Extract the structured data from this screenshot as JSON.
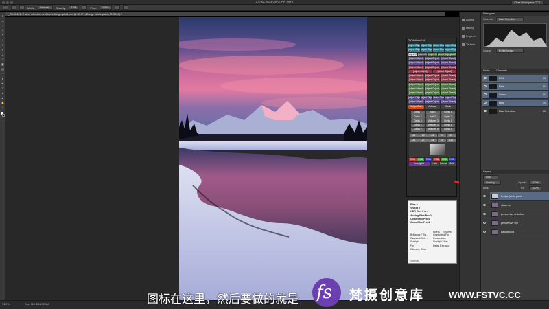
{
  "app": {
    "title": "Adobe Photoshop CC 2015"
  },
  "options_bar": {
    "mode_label": "Mode:",
    "mode_value": "Normal",
    "opacity_label": "Opacity:",
    "opacity_value": "10%",
    "flow_label": "Flow:",
    "flow_value": "100%",
    "workspace": "Chas Workspace CC2"
  },
  "document": {
    "tab_label": "_DKC2461--2 after reflection and trees dodge.tpbo1.psd @ 33.9% (Dodge (white paint), RGB/16) *"
  },
  "status": {
    "zoom": "33.9%",
    "doc_size": "Doc: 115.3M/196.9M"
  },
  "mini_panels": [
    "Actions",
    "History",
    "Properti...",
    "TK Actio..."
  ],
  "histogram": {
    "tab": "Histogram",
    "channel_label": "Channel:",
    "channel_value": "New Selection",
    "source_label": "Source:",
    "source_value": "Entire Image"
  },
  "channels": {
    "tabs": [
      "Paths",
      "Channels"
    ],
    "rows": [
      {
        "label": "RGB",
        "key": "⌘2"
      },
      {
        "label": "Red",
        "key": "⌘3"
      },
      {
        "label": "Green",
        "key": "⌘4"
      },
      {
        "label": "Blue",
        "key": "⌘5"
      },
      {
        "label": "New Selection",
        "key": "⌘6"
      }
    ]
  },
  "layers": {
    "tab": "Layers",
    "kind": "Kind",
    "blend": "Overlay",
    "opacity_label": "Opacity:",
    "opacity_value": "100%",
    "fill_label": "Fill:",
    "fill_value": "100%",
    "lock_label": "Lock:",
    "rows": [
      {
        "label": "Dodge (white paint)",
        "selected": true
      },
      {
        "label": "clean up",
        "selected": false
      },
      {
        "label": "perspective reflection",
        "selected": false
      },
      {
        "label": "perspective sky",
        "selected": false
      },
      {
        "label": "Background",
        "selected": false
      }
    ]
  },
  "plugin": {
    "title": "TK Actions V4",
    "tabs": [
      "Dodge&Burn",
      "Actions",
      "Basic"
    ],
    "footer": [
      "Help",
      "Tutorials",
      "Suite"
    ],
    "buttons_top": [
      {
        "label": "Zoom",
        "color": "#2f7a8c"
      },
      {
        "label": "Fit",
        "color": "#2f7a8c"
      },
      {
        "label": "100%",
        "color": "#2f7a8c"
      },
      {
        "label": "Print Size",
        "color": "#2f7a8c"
      },
      {
        "label": "New",
        "color": "#2f7a8c"
      },
      {
        "label": "Stamp",
        "color": "#2f7a8c"
      },
      {
        "label": "Fill",
        "color": "#2f7a8c"
      },
      {
        "label": "Blur",
        "color": "#2f7a8c"
      },
      {
        "label": "BW",
        "color": "#e0e0e0"
      },
      {
        "label": "BW",
        "color": "#555"
      },
      {
        "label": "Dup Image",
        "color": "#4a7a3a"
      },
      {
        "label": "Flatten",
        "color": "#4a7a3a"
      },
      {
        "label": "Save",
        "color": "#4a7a3a"
      },
      {
        "label": "Normal Layer",
        "color": "#5a4a8a"
      },
      {
        "label": "Screen",
        "color": "#5a4a8a"
      },
      {
        "label": "Multiply",
        "color": "#5a4a8a"
      },
      {
        "label": "Soft Light",
        "color": "#5a4a8a"
      },
      {
        "label": "Hard Light",
        "color": "#5a4a8a"
      },
      {
        "label": "Overlay",
        "color": "#5a4a8a"
      },
      {
        "label": "Layer Mask",
        "color": "#8a3a4a"
      },
      {
        "label": "Curves",
        "color": "#8a3a4a"
      },
      {
        "label": "Levels",
        "color": "#8a3a4a"
      },
      {
        "label": "Selective Color",
        "color": "#8a3a4a"
      },
      {
        "label": "Brightness/Contrast",
        "color": "#8a3a4a"
      },
      {
        "label": "Hue/Saturation",
        "color": "#8a3a4a"
      },
      {
        "label": "Vibrance",
        "color": "#8a3a4a"
      },
      {
        "label": "Match",
        "color": "#8a3a4a"
      },
      {
        "label": "Photo Filter",
        "color": "#8a3a4a"
      },
      {
        "label": "Color Balance",
        "color": "#8a3a4a"
      },
      {
        "label": "Fill",
        "color": "#8a3a4a"
      },
      {
        "label": "New Layer",
        "color": "#4a7a3a"
      },
      {
        "label": "Merge Visible",
        "color": "#4a7a3a"
      },
      {
        "label": "Burn",
        "color": "#4a7a3a"
      },
      {
        "label": "Dup Layer",
        "color": "#4a7a3a"
      },
      {
        "label": "Smart Object",
        "color": "#4a7a3a"
      },
      {
        "label": "Dodge",
        "color": "#4a7a3a"
      },
      {
        "label": "Delete Layer",
        "color": "#4a7a3a"
      },
      {
        "label": "Invert",
        "color": "#4a7a3a"
      },
      {
        "label": "Group",
        "color": "#4a7a3a"
      },
      {
        "label": "Undo",
        "color": "#5a4a8a"
      },
      {
        "label": "Unmask",
        "color": "#5a4a8a"
      },
      {
        "label": "Dodge",
        "color": "#5a4a8a"
      },
      {
        "label": "Save",
        "color": "#5a4a8a"
      },
      {
        "label": "View",
        "color": "#5a4a8a"
      },
      {
        "label": "Select",
        "color": "#5a4a8a"
      },
      {
        "label": "Clear Channels",
        "color": "#5a4a8a"
      }
    ],
    "dodge_rows": [
      [
        "Darks 1",
        "Mid 1",
        "Lights 1"
      ],
      [
        "Darks 2",
        "Mid 2",
        "Lights 2"
      ],
      [
        "Darks 3",
        "Midtones 3",
        "Lights 3"
      ],
      [
        "Darks 4",
        "Midtones 4",
        "Lights 4"
      ],
      [
        "Darks 5",
        "Midtones 5",
        "Lights 5"
      ]
    ],
    "zone_labels": [
      "Z1",
      "Z2",
      "Z3",
      "Z4",
      "Z5",
      "Z6",
      "Z7",
      "Z8",
      "Z9",
      "Z10"
    ],
    "bottom_row": [
      "Darks 5",
      "Midtones 5",
      "Lights 5"
    ],
    "mask_row": [
      "RGB",
      "RGB",
      "RGB",
      "RGB",
      "RGB",
      "RGB"
    ],
    "infinity_label": "Infinity Kit"
  },
  "filters": {
    "list": [
      "Efex 2",
      "Viveza 2",
      "HDR Efex Pro 2",
      "Analog Efex Pro 2",
      "Color Efex Pro 4",
      "Color Efex Pro 4"
    ],
    "col1": [
      "Brilliance / Wa...",
      "Classical Soft...",
      "Sunlight",
      "Fog",
      "Glamour Glow"
    ],
    "col2": [
      "Filters",
      "Recipes",
      "Graduated Fog",
      "Polarization",
      "Skylight Filter",
      "Detail Extractor"
    ],
    "footer": "Settings"
  },
  "subtitle": "图标在这里，然后要做的就是",
  "logo": {
    "mark": "fs",
    "name": "梵摄创意库",
    "url": "WWW.FSTVC.CC"
  },
  "colors": {
    "accent": "#596b84",
    "arrow": "#d42a2a"
  }
}
